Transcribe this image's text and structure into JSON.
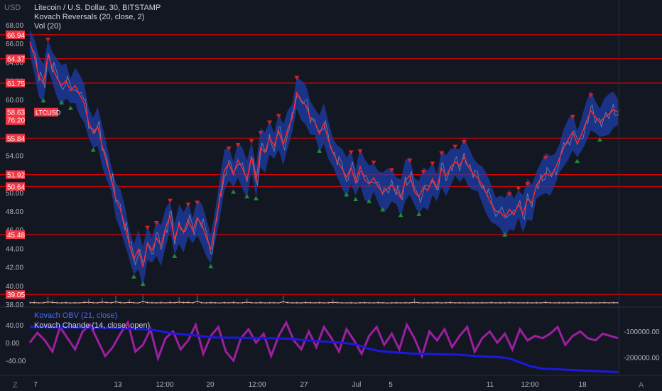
{
  "header": {
    "currency_label": "USD",
    "title": "Litecoin / U.S. Dollar, 30, BITSTAMP",
    "indicator_1": "Kovach Reversals (20, close, 2)",
    "indicator_2": "Vol (20)"
  },
  "price_tag": {
    "symbol": "LTCUSD",
    "price": "58.63",
    "countdown": "76:20"
  },
  "lower_panel": {
    "obv_label": "Kovach OBV (21, close)",
    "chande_label": "Kovach Chande (14, close, open)"
  },
  "footer": {
    "left_button": "Z",
    "right_button": "A"
  },
  "colors": {
    "background": "#131722",
    "level_line": "#e00000",
    "price_line": "#ff2a2a",
    "band": "#1e3ea8",
    "obv": "#1a1adf",
    "chande": "#9c1fa0",
    "sell_marker": "#d42020",
    "buy_marker": "#1e8b3a"
  },
  "chart_data": [
    {
      "type": "line",
      "title": "Litecoin / U.S. Dollar, 30, BITSTAMP",
      "ylabel": "USD",
      "ylim": [
        38,
        68
      ],
      "x_ticks": [
        "7",
        "13",
        "12:00",
        "20",
        "12:00",
        "27",
        "Jul",
        "5",
        "11",
        "12:00",
        "18"
      ],
      "y_ticks": [
        "40.00",
        "42.00",
        "44.00",
        "46.00",
        "48.00",
        "50.00",
        "52.00",
        "54.00",
        "56.00",
        "58.00",
        "60.00",
        "62.00",
        "64.00",
        "66.00",
        "68.00",
        "38.00"
      ],
      "level_lines": [
        "66.94",
        "64.37",
        "61.75",
        "55.84",
        "51.92",
        "50.64",
        "45.48",
        "39.05"
      ],
      "last_price": "58.63",
      "series": [
        {
          "name": "LTCUSD",
          "values": [
            66.2,
            64.6,
            62.5,
            61.7,
            64.8,
            63.4,
            62.3,
            61.5,
            62.0,
            60.9,
            61.5,
            60.5,
            59.6,
            57.5,
            56.4,
            57.1,
            55.0,
            53.2,
            51.5,
            49.2,
            48.2,
            46.5,
            44.4,
            42.8,
            43.9,
            42.0,
            44.6,
            43.8,
            45.1,
            44.3,
            46.2,
            47.5,
            45.0,
            46.6,
            45.7,
            47.1,
            45.9,
            47.3,
            46.6,
            45.2,
            43.9,
            46.5,
            49.4,
            52.4,
            53.1,
            51.9,
            53.5,
            52.6,
            51.4,
            53.9,
            51.2,
            54.8,
            54.3,
            55.9,
            55.0,
            56.6,
            55.1,
            56.8,
            58.0,
            60.7,
            59.9,
            59.4,
            58.0,
            57.6,
            56.3,
            57.4,
            55.6,
            54.3,
            53.3,
            52.6,
            51.6,
            52.7,
            51.1,
            52.8,
            51.4,
            50.9,
            51.6,
            50.6,
            50.0,
            50.4,
            50.8,
            50.2,
            49.4,
            51.3,
            51.8,
            50.1,
            49.5,
            50.6,
            50.2,
            51.5,
            50.5,
            52.6,
            51.8,
            52.7,
            53.3,
            52.9,
            53.8,
            52.7,
            52.0,
            51.6,
            50.8,
            49.8,
            48.8,
            48.0,
            47.9,
            47.3,
            48.2,
            47.6,
            48.8,
            47.7,
            49.3,
            48.9,
            50.8,
            51.5,
            52.1,
            51.8,
            52.4,
            53.6,
            54.8,
            55.7,
            56.5,
            55.2,
            56.3,
            57.6,
            58.8,
            58.1,
            57.5,
            58.1,
            58.4,
            58.9,
            58.63
          ]
        }
      ]
    },
    {
      "type": "bar",
      "title": "Vol (20)",
      "values": [
        1.2,
        1.5,
        0.8,
        1.0,
        3.0,
        1.8,
        1.1,
        0.9,
        1.3,
        0.7,
        1.0,
        0.8,
        1.6,
        2.2,
        1.1,
        0.9,
        2.6,
        1.4,
        1.0,
        3.4,
        1.2,
        0.8,
        2.0,
        1.1,
        0.7,
        3.9,
        1.3,
        1.0,
        0.9,
        1.2,
        0.8,
        1.5,
        1.0,
        2.8,
        1.2,
        1.6,
        0.8,
        4.2,
        1.1,
        0.9,
        1.3,
        1.0,
        0.7,
        1.2,
        0.9,
        1.4,
        0.8,
        1.0,
        2.4,
        1.1,
        0.9,
        1.3,
        0.8,
        1.0,
        1.1,
        0.7,
        3.6,
        1.2,
        0.9,
        1.0,
        0.8,
        1.5,
        1.1,
        0.9,
        1.2,
        0.8,
        1.0,
        2.1,
        1.3,
        0.9,
        0.8,
        1.1,
        0.7,
        1.0,
        1.2,
        0.9,
        0.8,
        1.3,
        1.0,
        0.7,
        0.9,
        1.1,
        0.8,
        1.0,
        0.9,
        2.5,
        1.1,
        0.8,
        1.0,
        0.9,
        1.2,
        0.8,
        1.0,
        1.4,
        0.9,
        1.1,
        0.8,
        0.9,
        1.0,
        0.8,
        1.1,
        0.9,
        1.3,
        0.8,
        1.0,
        0.9,
        1.2,
        0.8,
        1.0,
        0.9,
        1.1,
        0.8,
        1.0,
        0.9,
        1.6,
        1.0,
        0.8,
        1.1,
        0.9,
        1.0,
        0.8,
        1.2,
        1.0,
        0.9,
        1.1,
        0.8,
        1.0,
        1.3,
        0.9,
        1.2,
        1.0
      ]
    },
    {
      "type": "line",
      "ylim": [
        -60,
        60
      ],
      "y_ticks_left": [
        "40.00",
        "0.00",
        "-40.00"
      ],
      "y_ticks_right": [
        "-100000.00",
        "-200000.00"
      ],
      "series": [
        {
          "name": "Kovach OBV (21, close)",
          "values": [
            -84000,
            -84000,
            -85000,
            -85500,
            -86000,
            -86000,
            -86500,
            -87000,
            -88000,
            -90000,
            -92000,
            -94000,
            -100000,
            -108000,
            -112000,
            -116000,
            -120000,
            -124000,
            -125000,
            -125000,
            -126000,
            -126000,
            -127000,
            -128000,
            -130000,
            -134000,
            -137000,
            -140000,
            -143000,
            -146000,
            -152000,
            -166000,
            -176000,
            -180000,
            -183000,
            -186000,
            -187000,
            -188000,
            -189000,
            -190000,
            -193000,
            -196000,
            -198000,
            -200000,
            -205000,
            -220000,
            -236000,
            -244000,
            -246000,
            -248000,
            -250000,
            -252000,
            -254000,
            -256000,
            -258000
          ]
        },
        {
          "name": "Kovach Chande (14, close, open)",
          "values": [
            0,
            22,
            5,
            -20,
            35,
            10,
            -15,
            25,
            40,
            5,
            -30,
            -10,
            20,
            45,
            -20,
            -5,
            30,
            -35,
            10,
            25,
            -15,
            5,
            40,
            -25,
            15,
            35,
            -20,
            -40,
            10,
            30,
            0,
            20,
            -30,
            15,
            45,
            5,
            -15,
            25,
            -10,
            35,
            10,
            -20,
            30,
            5,
            -25,
            15,
            35,
            -5,
            20,
            -15,
            40,
            10,
            -30,
            25,
            5,
            30,
            -10,
            15,
            35,
            -20,
            10,
            25,
            0,
            20,
            -15,
            30,
            5,
            15,
            10,
            20,
            35,
            -5,
            15,
            25,
            10,
            5,
            20,
            15,
            10
          ]
        }
      ]
    }
  ]
}
